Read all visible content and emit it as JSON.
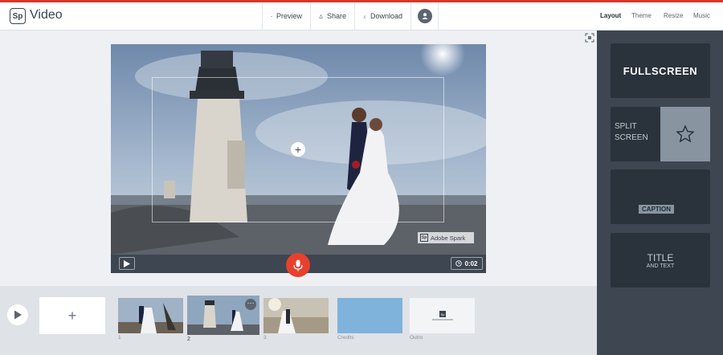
{
  "app": {
    "logo": "Sp",
    "title": "Video"
  },
  "toolbar": {
    "preview": "Preview",
    "share": "Share",
    "download": "Download"
  },
  "right_tabs": {
    "layout": "Layout",
    "theme": "Theme",
    "resize": "Resize",
    "music": "Music",
    "active": "Layout"
  },
  "player": {
    "duration": "0:02",
    "watermark_logo": "Sp",
    "watermark_text": "Adobe Spark"
  },
  "layouts": {
    "fullscreen": "FULLSCREEN",
    "split_line1": "SPLIT",
    "split_line2": "SCREEN",
    "caption": "CAPTION",
    "title_main": "TITLE",
    "title_sub": "AND TEXT"
  },
  "timeline": {
    "add_label": "+",
    "slides": [
      {
        "label": "1"
      },
      {
        "label": "2",
        "selected": true
      },
      {
        "label": "3"
      },
      {
        "label": "Credits"
      },
      {
        "label": "Outro"
      }
    ],
    "outro_logo": "Sp"
  },
  "colors": {
    "accent": "#e8402d",
    "topbar_stripe": "#d8372a",
    "sidebar": "#3d4651",
    "credits_slide": "#7fb3dc"
  },
  "icons": [
    "eye-icon",
    "share-icon",
    "download-icon",
    "avatar-icon",
    "fullscreen-toggle-icon",
    "play-icon",
    "microphone-icon",
    "clock-icon",
    "star-icon",
    "more-icon",
    "add-icon"
  ]
}
